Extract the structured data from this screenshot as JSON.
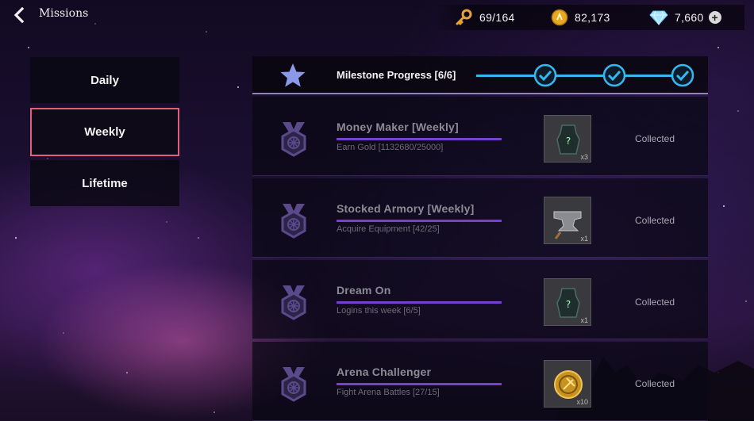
{
  "header": {
    "title": "Missions",
    "back_icon": "chevron-left-icon"
  },
  "currencies": {
    "keys": {
      "icon": "key-icon",
      "value": "69/164"
    },
    "gold": {
      "icon": "gold-coin-icon",
      "value": "82,173"
    },
    "gems": {
      "icon": "diamond-icon",
      "value": "7,660",
      "add_label": "+"
    }
  },
  "tabs": [
    {
      "label": "Daily",
      "active": false
    },
    {
      "label": "Weekly",
      "active": true
    },
    {
      "label": "Lifetime",
      "active": false
    }
  ],
  "milestone": {
    "label": "Milestone Progress [6/6]",
    "icon": "star-icon",
    "completed_checks": 3,
    "accent_color": "#35b8ee"
  },
  "missions": [
    {
      "title": "Money Maker [Weekly]",
      "description": "Earn Gold [1132680/25000]",
      "reward_icon": "mystery-gear-icon",
      "reward_qty": "x3",
      "status": "Collected"
    },
    {
      "title": "Stocked Armory [Weekly]",
      "description": "Acquire Equipment [42/25]",
      "reward_icon": "anvil-icon",
      "reward_qty": "x1",
      "status": "Collected"
    },
    {
      "title": "Dream On",
      "description": "Logins this week [6/5]",
      "reward_icon": "mystery-gear-icon",
      "reward_qty": "x1",
      "status": "Collected"
    },
    {
      "title": "Arena Challenger",
      "description": "Fight Arena Battles [27/15]",
      "reward_icon": "arena-coin-icon",
      "reward_qty": "x10",
      "status": "Collected"
    }
  ],
  "colors": {
    "active_tab_border": "#e0607a",
    "progress_bar": "#7a3fd1"
  }
}
